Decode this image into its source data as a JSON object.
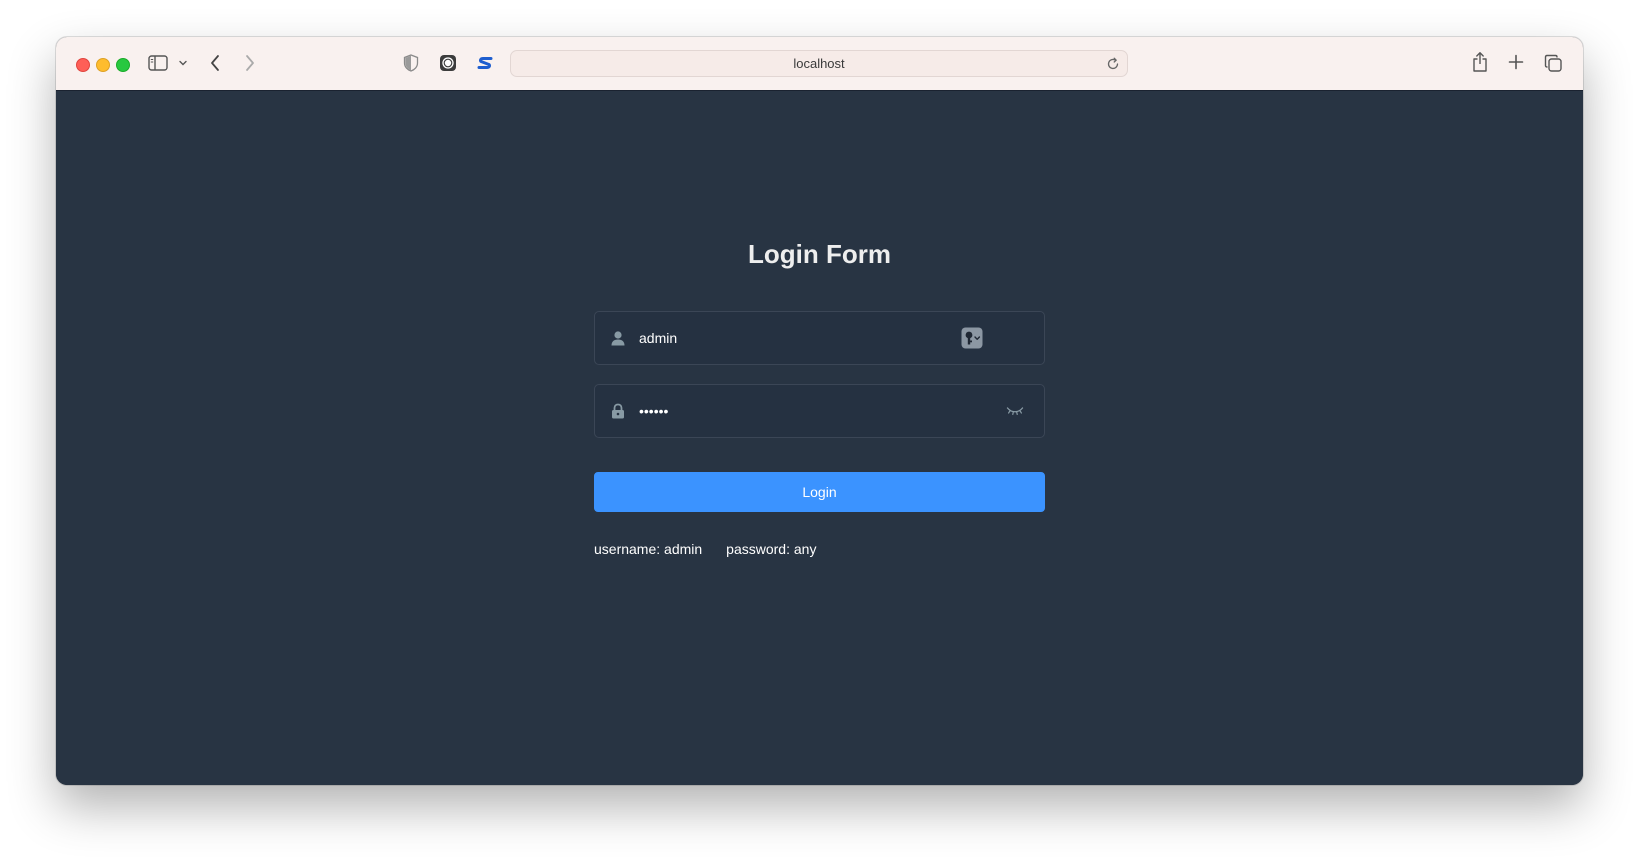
{
  "browser": {
    "url": "localhost"
  },
  "icons": {
    "sidebar": "sidebar-icon",
    "back": "chevron-left-icon",
    "forward": "chevron-right-icon",
    "privacy": "shield-icon",
    "extension1": "record-icon",
    "extension2": "s-logo-icon",
    "reload": "reload-icon",
    "share": "share-icon",
    "new_tab": "plus-icon",
    "tabs": "tab-overview-icon",
    "user": "user-icon",
    "lock": "lock-icon",
    "password_manager": "key-icon",
    "toggle_password": "eye-closed-icon"
  },
  "colors": {
    "page_background": "#283443",
    "button": "#3b93ff",
    "toolbar": "#f9f1ef"
  },
  "form": {
    "title": "Login Form",
    "username_value": "admin",
    "password_value": "••••••",
    "login_label": "Login",
    "tip_username": "username: admin",
    "tip_password": "password: any"
  }
}
